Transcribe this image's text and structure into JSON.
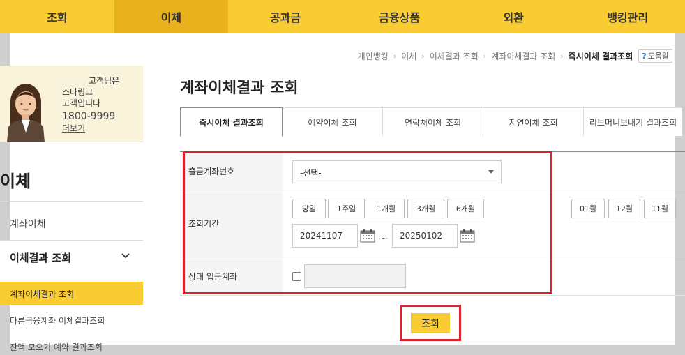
{
  "nav": [
    "조회",
    "이체",
    "공과금",
    "금융상품",
    "외환",
    "뱅킹관리"
  ],
  "breadcrumb": [
    "개인뱅킹",
    "이체",
    "이체결과 조회",
    "계좌이체결과 조회",
    "즉시이체 결과조회"
  ],
  "help": {
    "icon": "?",
    "label": "도움말"
  },
  "profile": {
    "line1": "고객님은",
    "line2": "스타링크",
    "line3": "고객입니다",
    "phone": "1800-9999",
    "more": "더보기"
  },
  "sidebar": {
    "title": "이체",
    "item1": "계좌이체",
    "section": "이체결과 조회",
    "sub_active": "계좌이체결과 조회",
    "sub2": "다른금융계좌 이체결과조회",
    "sub3": "잔액 모으기 예약 결과조회"
  },
  "page_title": "계좌이체결과 조회",
  "tabs": [
    "즉시이체 결과조회",
    "예약이체 조회",
    "연락처이체 조회",
    "지연이체 조회",
    "리브머니보내기 결과조회"
  ],
  "form": {
    "account_label": "출금계좌번호",
    "account_select": "-선택-",
    "period_label": "조회기간",
    "period_buttons": [
      "당일",
      "1주일",
      "1개월",
      "3개월",
      "6개월"
    ],
    "month_buttons": [
      "01월",
      "12월",
      "11월"
    ],
    "date_from": "20241107",
    "tilde": "~",
    "date_to": "20250102",
    "counter_label": "상대 입금계좌"
  },
  "submit_label": "조회",
  "colors": {
    "brand_yellow": "#f8cc32",
    "highlight_red": "#e0202a"
  }
}
